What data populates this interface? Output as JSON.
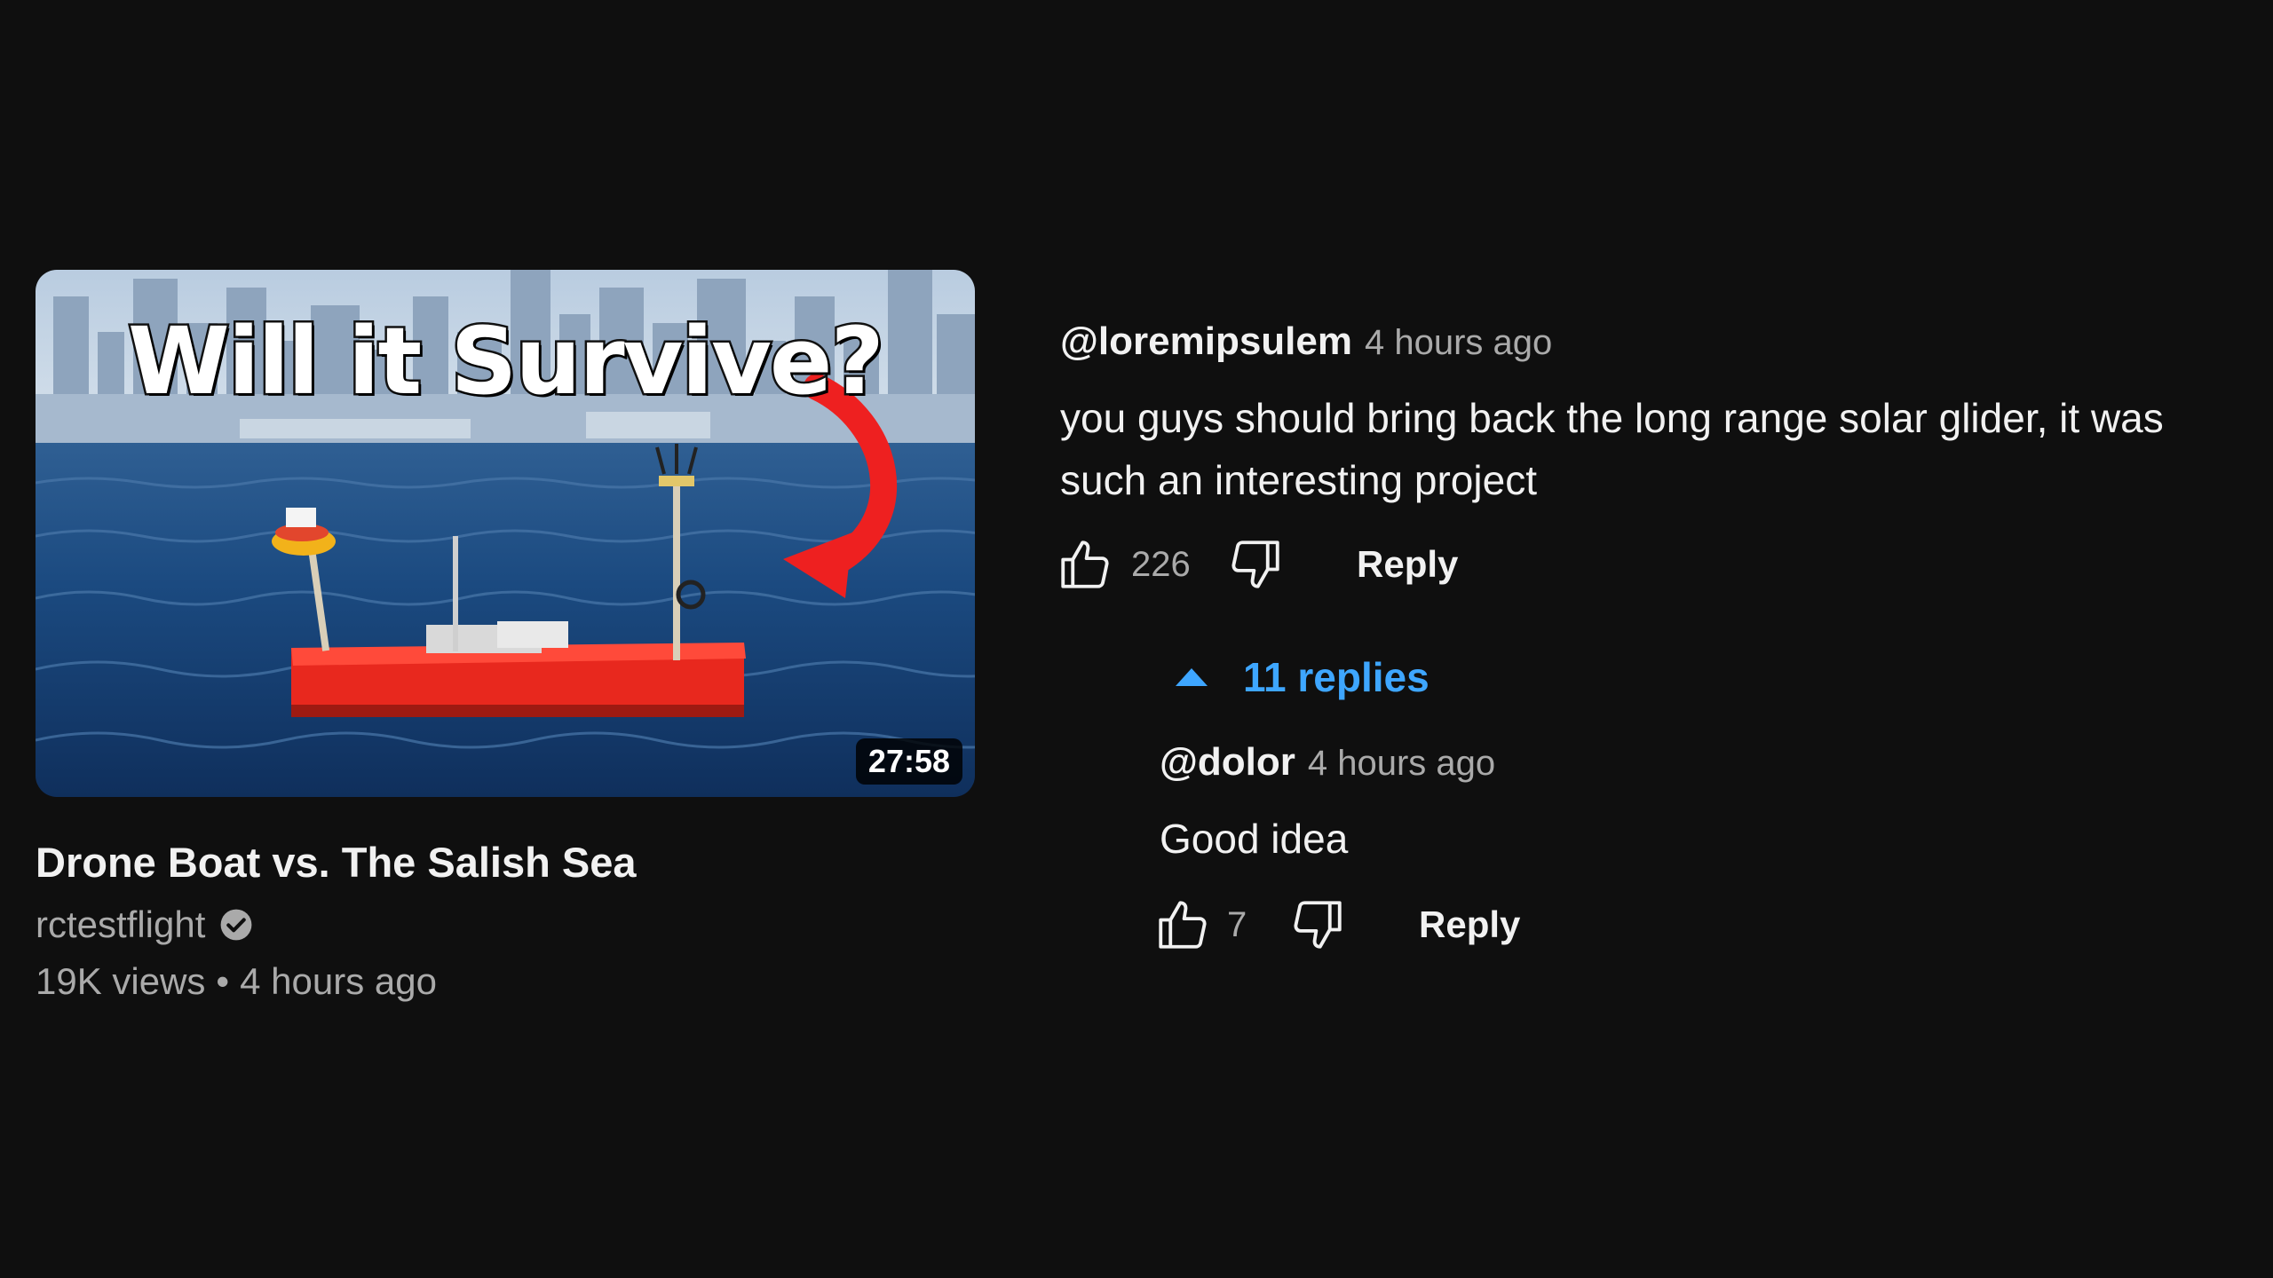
{
  "video": {
    "thumbnail_text": "Will it Survive?",
    "duration": "27:58",
    "title": "Drone Boat vs. The Salish Sea",
    "channel": "rctestflight",
    "views": "19K views",
    "separator": "•",
    "age": "4 hours ago"
  },
  "comment": {
    "author": "@loremipsulem",
    "time": "4 hours ago",
    "text": "you guys should bring back the long range solar glider, it was such an interesting project",
    "likes": "226",
    "reply_label": "Reply"
  },
  "replies_toggle": {
    "label": "11 replies"
  },
  "reply": {
    "author": "@dolor",
    "time": "4 hours ago",
    "text": "Good idea",
    "likes": "7",
    "reply_label": "Reply"
  },
  "colors": {
    "background": "#0f0f0f",
    "link_blue": "#3ea6ff",
    "secondary_text": "#aaaaaa",
    "boat_red": "#e8281e"
  }
}
